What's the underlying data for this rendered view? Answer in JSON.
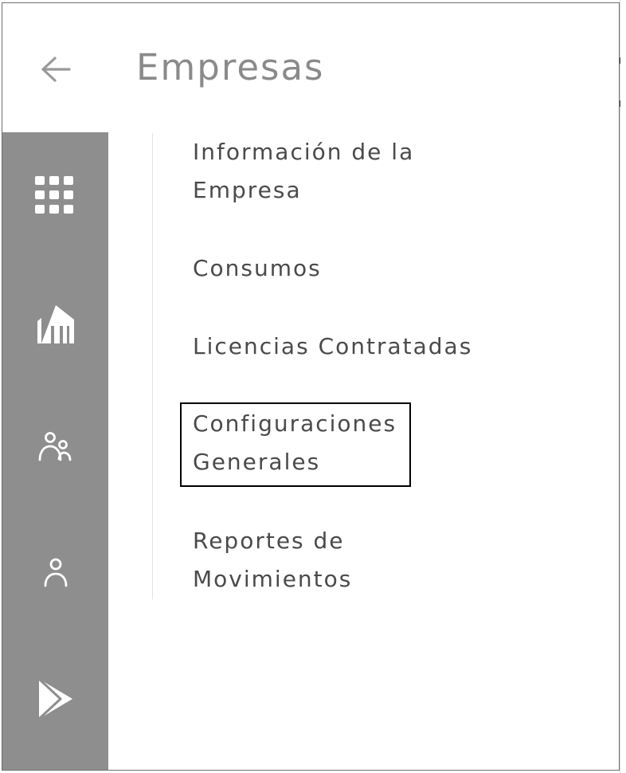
{
  "header": {
    "title": "Empresas",
    "back_icon": "arrow-left-icon"
  },
  "sidebar": {
    "items": [
      {
        "icon": "grid-icon"
      },
      {
        "icon": "building-icon"
      },
      {
        "icon": "users-icon"
      },
      {
        "icon": "user-icon"
      },
      {
        "icon": "play-store-icon"
      }
    ]
  },
  "menu": {
    "items": [
      {
        "line1": "Información de la",
        "line2": "Empresa"
      },
      {
        "line1": "Consumos"
      },
      {
        "line1": "Licencias Contratadas"
      },
      {
        "line1": "Configuraciones",
        "line2": "Generales",
        "selected": true
      },
      {
        "line1": "Reportes de",
        "line2": "Movimientos"
      }
    ]
  },
  "colors": {
    "sidebar_bg": "#8e8e8e",
    "title_text": "#8a8a8a",
    "menu_text": "#4a4a4a",
    "icon": "#ffffff",
    "selection_border": "#000000"
  }
}
